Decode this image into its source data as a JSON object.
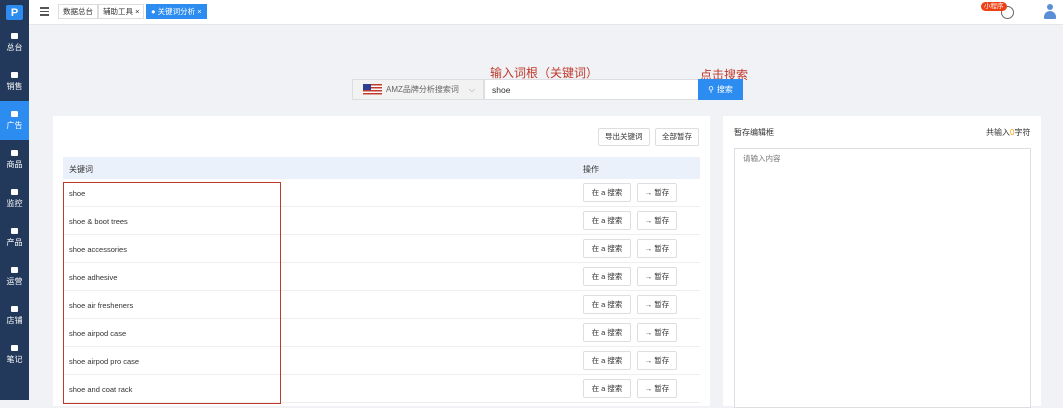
{
  "sidebar": {
    "logo": "P",
    "items": [
      {
        "label": "总台",
        "active": false
      },
      {
        "label": "销售",
        "active": false
      },
      {
        "label": "广告",
        "active": true
      },
      {
        "label": "商品",
        "active": false
      },
      {
        "label": "监控",
        "active": false
      },
      {
        "label": "产品",
        "active": false
      },
      {
        "label": "运营",
        "active": false
      },
      {
        "label": "店铺",
        "active": false
      },
      {
        "label": "笔记",
        "active": false
      }
    ]
  },
  "topbar": {
    "tabs": [
      "数据总台",
      "辅助工具 ×",
      "● 关键词分析 ×"
    ],
    "mini_program": "小程序"
  },
  "annotations": {
    "input_hint": "输入词根（关键词）",
    "click_hint": "点击搜索"
  },
  "search": {
    "site_label": "AMZ品牌分析搜索词",
    "value": "shoe",
    "button": "搜索"
  },
  "actions": {
    "export": "导出关键词",
    "stash_all": "全部暂存"
  },
  "table": {
    "headers": [
      "关键词",
      "操作"
    ],
    "row_actions": [
      "在 a 搜索",
      "→ 暂存"
    ],
    "rows": [
      "shoe",
      "shoe & boot trees",
      "shoe accessories",
      "shoe adhesive",
      "shoe air fresheners",
      "shoe airpod case",
      "shoe airpod pro case",
      "shoe and coat rack"
    ]
  },
  "editor": {
    "title": "暂存编辑框",
    "count_prefix": "共输入",
    "count": "0",
    "count_suffix": "字符",
    "placeholder": "请输入内容"
  },
  "colors": {
    "sidebar": "#22395b",
    "accent": "#2d8cf0",
    "annotation": "#c0392b"
  }
}
